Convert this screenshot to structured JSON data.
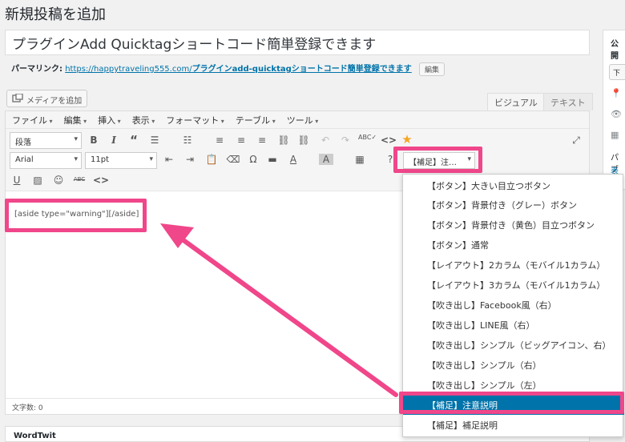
{
  "page": {
    "title": "新規投稿を追加"
  },
  "post": {
    "title": "プラグインAdd Quicktagショートコード簡単登録できます",
    "permalink_label": "パーマリンク:",
    "permalink_base": "https://happytraveling555.com/",
    "permalink_slug": "プラグインadd-quicktagショートコード簡単登録できます",
    "permalink_edit": "編集"
  },
  "editor": {
    "add_media": "メディアを追加",
    "tabs": {
      "visual": "ビジュアル",
      "text": "テキスト"
    },
    "menubar": [
      "ファイル",
      "編集",
      "挿入",
      "表示",
      "フォーマット",
      "テーブル",
      "ツール"
    ],
    "paragraph_select": "段落",
    "font_select": "Arial",
    "size_select": "11pt",
    "quicktag_select": "【補足】注…",
    "content": "[aside type=\"warning\"][/aside]",
    "word_count": "文字数: 0"
  },
  "quicktag_menu": {
    "items": [
      "【ボタン】大きい目立つボタン",
      "【ボタン】背景付き（グレー）ボタン",
      "【ボタン】背景付き（黄色）目立つボタン",
      "【ボタン】通常",
      "【レイアウト】2カラム（モバイル1カラム）",
      "【レイアウト】3カラム（モバイル1カラム）",
      "【吹き出し】Facebook風（右）",
      "【吹き出し】LINE風（右）",
      "【吹き出し】シンプル（ビッグアイコン、右）",
      "【吹き出し】シンプル（右）",
      "【吹き出し】シンプル（左）",
      "【補足】注意説明",
      "【補足】補足説明"
    ],
    "selected_index": 11
  },
  "metabox": {
    "wordtwit": "WordTwit"
  },
  "sidebar": {
    "publish_title": "公開",
    "preview_btn": "下",
    "paypal_text": "パブ",
    "link_text": "表示"
  },
  "colors": {
    "highlight": "#f0468a",
    "link": "#0073aa",
    "selected": "#0073aa"
  },
  "icons": [
    "media-icon",
    "bold-icon",
    "italic-icon",
    "blockquote-icon",
    "bullet-list-icon",
    "numbered-list-icon",
    "align-left-icon",
    "align-center-icon",
    "align-right-icon",
    "link-icon",
    "unlink-icon",
    "undo-icon",
    "redo-icon",
    "spellcheck-icon",
    "code-icon",
    "star-icon",
    "fullscreen-icon",
    "outdent-icon",
    "indent-icon",
    "paste-icon",
    "eraser-icon",
    "omega-icon",
    "horizontal-rule-icon",
    "text-color-icon",
    "background-color-icon",
    "table-icon",
    "help-icon",
    "underline-icon",
    "image-icon",
    "emoji-icon",
    "strikethrough-icon",
    "pin-icon",
    "eye-icon",
    "calendar-icon"
  ]
}
